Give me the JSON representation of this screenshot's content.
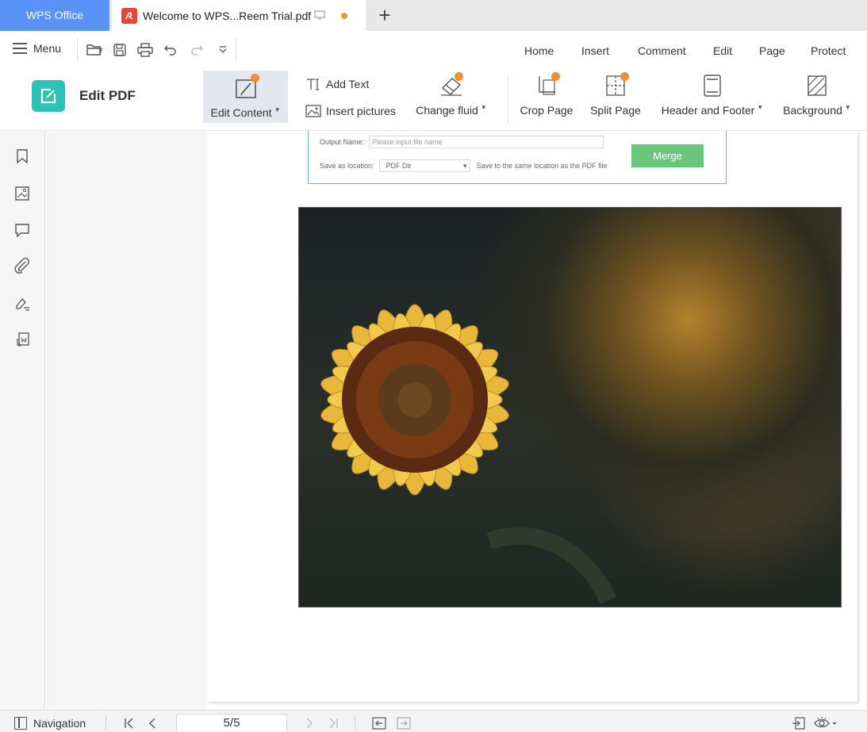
{
  "titlebar": {
    "app_tab": "WPS Office",
    "doc_tab": "Welcome to WPS...Reem Trial.pdf",
    "modified_dot_color": "#e89a2c",
    "new_tab_symbol": "+"
  },
  "menubar": {
    "menu_label": "Menu",
    "ribbon_tabs": [
      "Home",
      "Insert",
      "Comment",
      "Edit",
      "Page",
      "Protect"
    ]
  },
  "ribbon": {
    "edit_pdf_label": "Edit PDF",
    "edit_content": "Edit Content",
    "add_text": "Add Text",
    "insert_pictures": "Insert pictures",
    "change_fluid": "Change fluid",
    "crop_page": "Crop Page",
    "split_page": "Split Page",
    "header_footer": "Header and Footer",
    "background": "Background"
  },
  "sidebar": {
    "icons": [
      "bookmark-icon",
      "image-thumbnail-icon",
      "comment-icon",
      "attachment-icon",
      "signature-icon",
      "convert-icon"
    ]
  },
  "document": {
    "merge_dialog": {
      "output_name_label": "Output Name:",
      "output_name_placeholder": "Please input file name",
      "save_location_label": "Save as location:",
      "save_location_value": "PDF Dir",
      "save_location_hint": "Save to the same location as the PDF file",
      "merge_button": "Merge"
    },
    "image_subject": "sunflower-photo"
  },
  "statusbar": {
    "navigation_label": "Navigation",
    "page_indicator": "5/5"
  },
  "colors": {
    "app_tab_bg": "#5a92f7",
    "edit_pdf_accent": "#2cc3b5",
    "merge_button_bg": "#6cc57a",
    "badge_orange": "#ef8f33"
  }
}
